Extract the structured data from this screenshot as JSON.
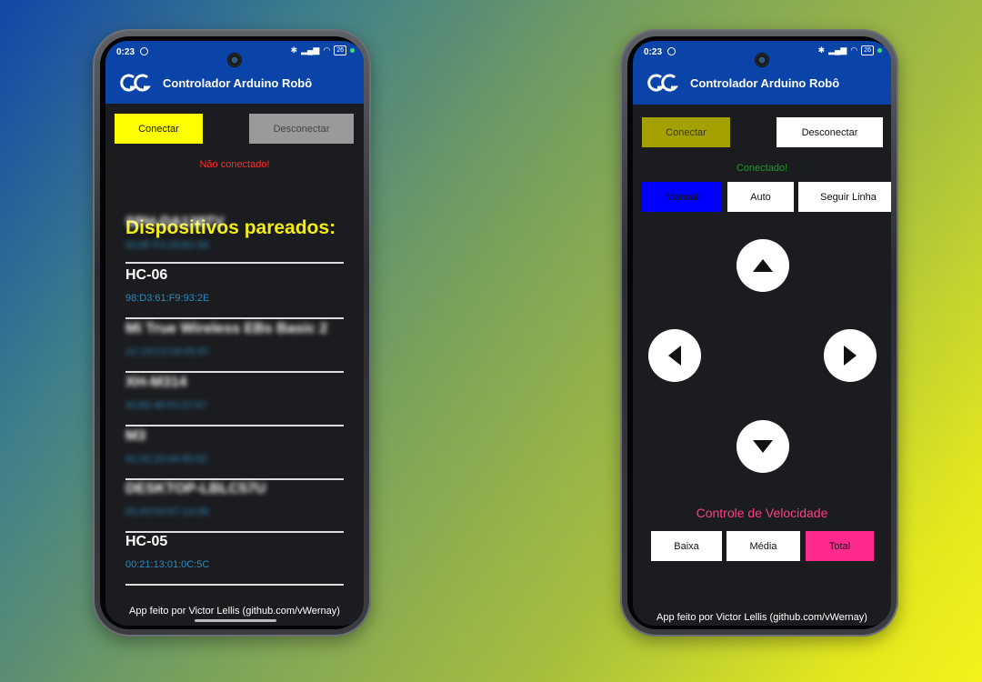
{
  "app": {
    "title": "Controlador Arduino Robô",
    "footer": "App feito por Victor Lellis (github.com/vWernay)"
  },
  "status_bar": {
    "time": "0:23",
    "battery": "26"
  },
  "left_screen": {
    "connect_label": "Conectar",
    "disconnect_label": "Desconectar",
    "status_text": "Não conectado!",
    "status_color": "#ff2a2a",
    "devices_title": "Dispositivos pareados:",
    "devices": [
      {
        "name": "SPH-DA138TV",
        "mac": "00:6F:F2:29:B1:56",
        "blurred": true
      },
      {
        "name": "HC-06",
        "mac": "98:D3:61:F9:93:2E",
        "blurred": false
      },
      {
        "name": "Mi True Wireless EBs Basic 2",
        "mac": "1C:19:C2:04:05:97",
        "blurred": true
      },
      {
        "name": "XH-M314",
        "mac": "40:80:48:F0:37:67",
        "blurred": true
      },
      {
        "name": "M3",
        "mac": "41:42:15:0A:80:52",
        "blurred": true
      },
      {
        "name": "DESKTOP-LBLC57U",
        "mac": "00:A5:54:57:1A:08",
        "blurred": true
      },
      {
        "name": "HC-05",
        "mac": "00:21:13:01:0C:5C",
        "blurred": false
      }
    ]
  },
  "right_screen": {
    "connect_label": "Conectar",
    "disconnect_label": "Desconectar",
    "status_text": "Conectado!",
    "status_color": "#1f9a2a",
    "modes": [
      "Manual",
      "Auto",
      "Seguir Linha"
    ],
    "active_mode": "Manual",
    "speed_title": "Controle de Velocidade",
    "speeds": [
      "Baixa",
      "Média",
      "Total"
    ],
    "active_speed": "Total"
  },
  "colors": {
    "appbar": "#0a44a8",
    "connect_yellow": "#ffff00",
    "connect_dim": "#a3a000",
    "disconnect_gray": "#9a9a9a",
    "mode_active": "#0000ff",
    "speed_active": "#ff2a8c",
    "title_yellow": "#f2ee12",
    "mac_blue": "#2b8bc0"
  },
  "icons": [
    "logo-icon",
    "arrow-up-icon",
    "arrow-left-icon",
    "arrow-right-icon",
    "arrow-down-icon",
    "bluetooth-icon",
    "signal-icon",
    "wifi-icon",
    "battery-icon"
  ]
}
